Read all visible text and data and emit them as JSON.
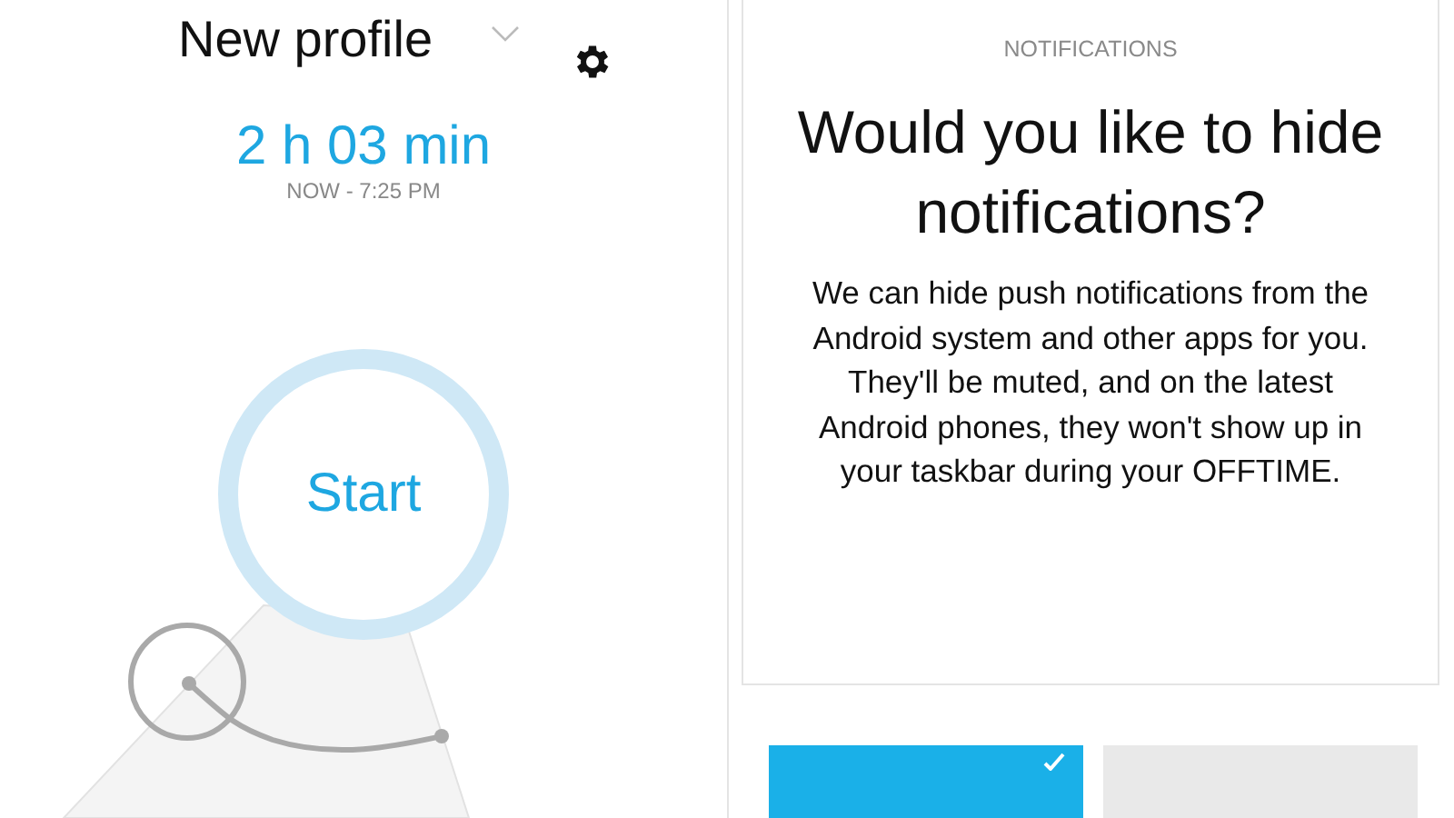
{
  "profile": {
    "title": "New profile"
  },
  "timer": {
    "duration": "2 h 03 min",
    "range": "NOW - 7:25 PM",
    "start_label": "Start"
  },
  "dialog": {
    "heading": "NOTIFICATIONS",
    "title": "Would you like to hide notifications?",
    "body": "We can hide push notifications from the Android system and other apps for you. They'll be muted, and on the latest Android phones, they won't show up in your taskbar during your OFFTIME.",
    "buttons": [
      {
        "kind": "primary"
      },
      {
        "kind": "secondary"
      }
    ]
  }
}
